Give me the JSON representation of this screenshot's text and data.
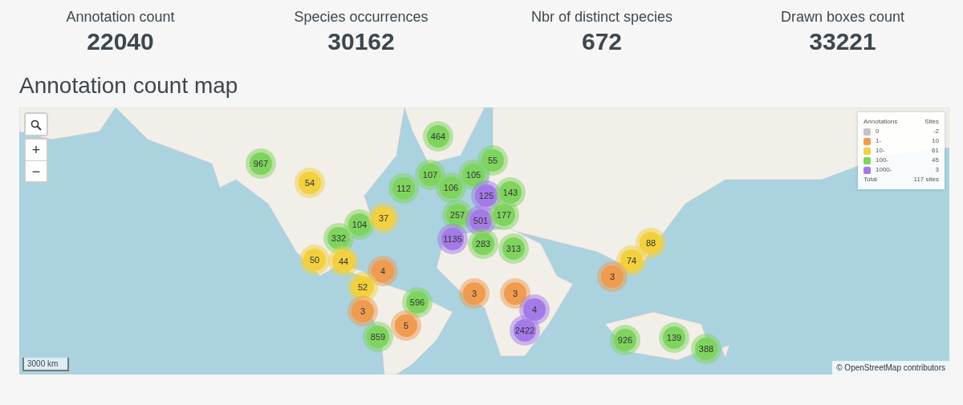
{
  "stats": [
    {
      "label": "Annotation count",
      "value": "22040"
    },
    {
      "label": "Species occurrences",
      "value": "30162"
    },
    {
      "label": "Nbr of distinct species",
      "value": "672"
    },
    {
      "label": "Drawn boxes count",
      "value": "33221"
    }
  ],
  "map_title": "Annotation count map",
  "map": {
    "controls": [
      "+",
      "−"
    ],
    "markers": [
      {
        "label": "464",
        "color": "#7fd45f"
      },
      {
        "label": "967",
        "color": "#7fd45f"
      },
      {
        "label": "55",
        "color": "#7fd45f"
      },
      {
        "label": "54",
        "color": "#f2d03f"
      },
      {
        "label": "112",
        "color": "#7fd45f"
      },
      {
        "label": "107",
        "color": "#7fd45f"
      },
      {
        "label": "106",
        "color": "#7fd45f"
      },
      {
        "label": "105",
        "color": "#7fd45f"
      },
      {
        "label": "125",
        "color": "#a47ae8"
      },
      {
        "label": "143",
        "color": "#7fd45f"
      },
      {
        "label": "104",
        "color": "#7fd45f"
      },
      {
        "label": "37",
        "color": "#f2d03f"
      },
      {
        "label": "257",
        "color": "#7fd45f"
      },
      {
        "label": "501",
        "color": "#a47ae8"
      },
      {
        "label": "177",
        "color": "#7fd45f"
      },
      {
        "label": "332",
        "color": "#7fd45f"
      },
      {
        "label": "1135",
        "color": "#a47ae8"
      },
      {
        "label": "283",
        "color": "#7fd45f"
      },
      {
        "label": "313",
        "color": "#7fd45f"
      },
      {
        "label": "88",
        "color": "#f2d03f"
      },
      {
        "label": "50",
        "color": "#f2d03f"
      },
      {
        "label": "44",
        "color": "#f2d03f"
      },
      {
        "label": "74",
        "color": "#f2d03f"
      },
      {
        "label": "4",
        "color": "#ef9b50"
      },
      {
        "label": "3",
        "color": "#ef9b50"
      },
      {
        "label": "52",
        "color": "#f2d03f"
      },
      {
        "label": "3",
        "color": "#ef9b50"
      },
      {
        "label": "3",
        "color": "#ef9b50"
      },
      {
        "label": "3",
        "color": "#ef9b50"
      },
      {
        "label": "596",
        "color": "#7fd45f"
      },
      {
        "label": "4",
        "color": "#a47ae8"
      },
      {
        "label": "5",
        "color": "#ef9b50"
      },
      {
        "label": "2422",
        "color": "#a47ae8"
      },
      {
        "label": "859",
        "color": "#7fd45f"
      },
      {
        "label": "926",
        "color": "#7fd45f"
      },
      {
        "label": "139",
        "color": "#7fd45f"
      },
      {
        "label": "388",
        "color": "#7fd45f"
      }
    ],
    "legend": {
      "header": [
        "Annotations",
        "Sites"
      ],
      "rows": [
        {
          "label": "0",
          "sites": "-2",
          "color": "#c4c4c4"
        },
        {
          "label": "1-",
          "sites": "10",
          "color": "#ef9b50"
        },
        {
          "label": "10-",
          "sites": "61",
          "color": "#f2d03f"
        },
        {
          "label": "100-",
          "sites": "45",
          "color": "#7fd45f"
        },
        {
          "label": "1000-",
          "sites": "3",
          "color": "#a47ae8"
        }
      ],
      "total": {
        "label": "Total",
        "sites": "117 sites"
      }
    },
    "scale": "3000 km",
    "attribution": "© OpenStreetMap contributors"
  }
}
